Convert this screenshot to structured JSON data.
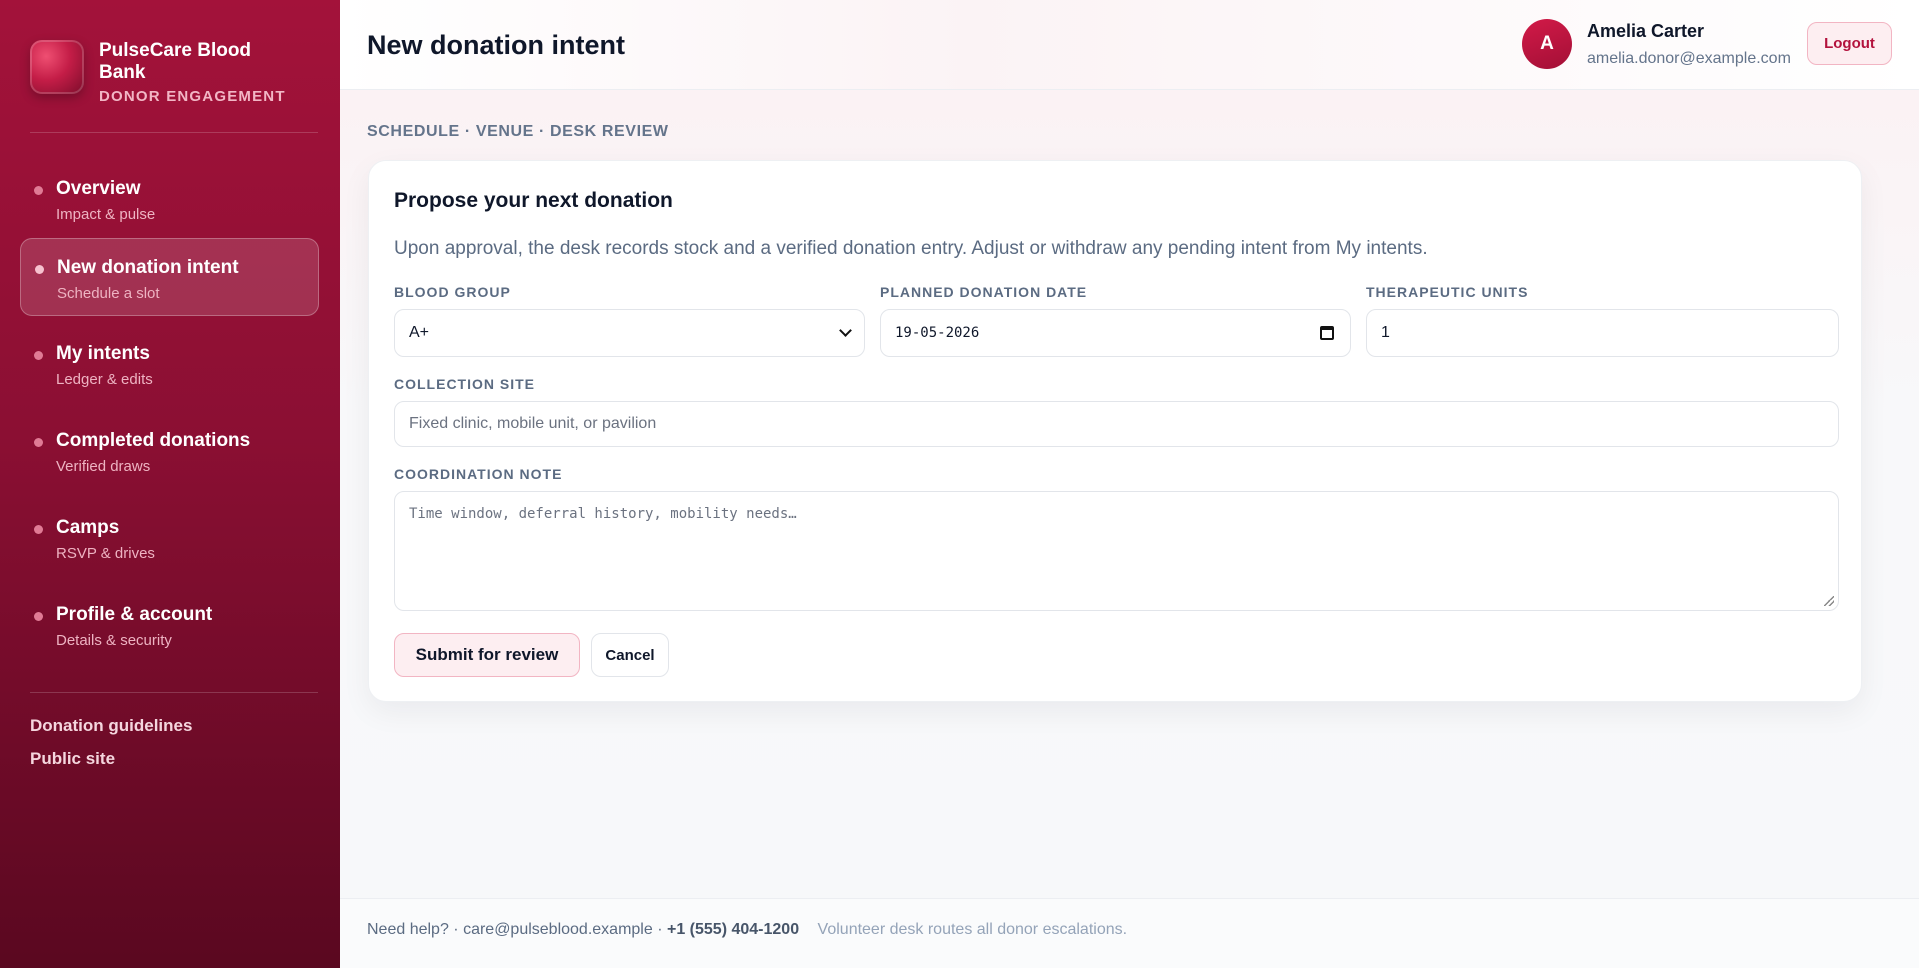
{
  "brand": {
    "name": "PulseCare Blood Bank",
    "subtitle": "DONOR ENGAGEMENT"
  },
  "nav": [
    {
      "label": "Overview",
      "sub": "Impact & pulse"
    },
    {
      "label": "New donation intent",
      "sub": "Schedule a slot",
      "active": true
    },
    {
      "label": "My intents",
      "sub": "Ledger & edits"
    },
    {
      "label": "Completed donations",
      "sub": "Verified draws"
    },
    {
      "label": "Camps",
      "sub": "RSVP & drives"
    },
    {
      "label": "Profile & account",
      "sub": "Details & security"
    }
  ],
  "side_links": [
    "Donation guidelines",
    "Public site"
  ],
  "header": {
    "title": "New donation intent",
    "avatar_initial": "A",
    "user_name": "Amelia Carter",
    "user_email": "amelia.donor@example.com",
    "logout_label": "Logout"
  },
  "breadcrumb": "SCHEDULE · VENUE · DESK REVIEW",
  "form": {
    "title": "Propose your next donation",
    "description": "Upon approval, the desk records stock and a verified donation entry. Adjust or withdraw any pending intent from My intents.",
    "blood_group": {
      "label": "BLOOD GROUP",
      "value": "A+"
    },
    "date": {
      "label": "PLANNED DONATION DATE",
      "value": "19-05-2026"
    },
    "units": {
      "label": "THERAPEUTIC UNITS",
      "value": "1"
    },
    "site": {
      "label": "COLLECTION SITE",
      "placeholder": "Fixed clinic, mobile unit, or pavilion"
    },
    "note": {
      "label": "COORDINATION NOTE",
      "placeholder": "Time window, deferral history, mobility needs…"
    },
    "submit_label": "Submit for review",
    "cancel_label": "Cancel"
  },
  "footer": {
    "help": "Need help? · care@pulseblood.example ·",
    "phone": "+1 (555) 404-1200",
    "note": "Volunteer desk routes all donor escalations."
  },
  "colors": {
    "sidebar": "#a3123a",
    "accent": "#b3123d",
    "accent_soft": "#fdeef1"
  }
}
